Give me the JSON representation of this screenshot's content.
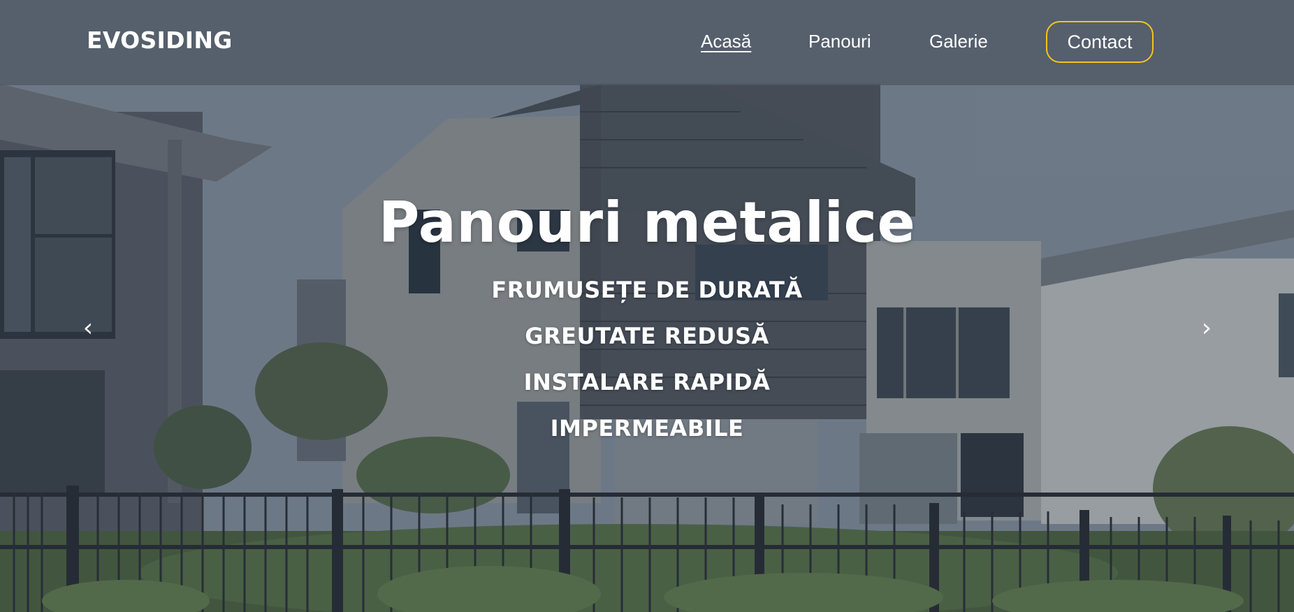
{
  "header": {
    "logo": "EVOSIDING",
    "nav": {
      "home": "Acasă",
      "panels": "Panouri",
      "gallery": "Galerie",
      "contact": "Contact"
    },
    "active_item": "home"
  },
  "hero": {
    "title": "Panouri metalice",
    "features": [
      "FRUMUSEȚE DE DURATĂ",
      "GREUTATE REDUSĂ",
      "INSTALARE RAPIDĂ",
      "IMPERMEABILE"
    ],
    "prev_arrow": "‹",
    "next_arrow": "›",
    "background_image": "modern-house-metal-siding-photo"
  },
  "colors": {
    "contact_border": "#f2c617",
    "text": "#ffffff"
  }
}
